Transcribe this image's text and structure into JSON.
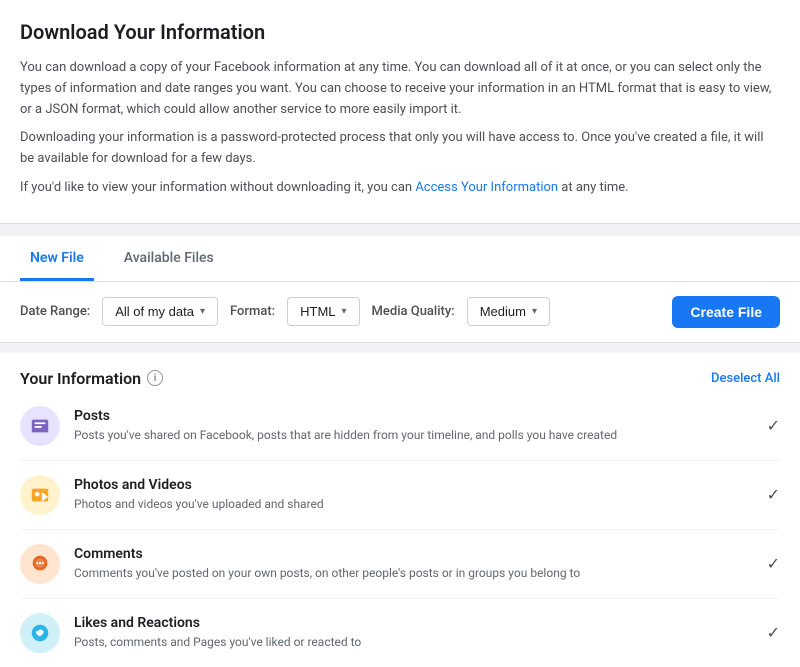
{
  "page": {
    "title": "Download Your Information",
    "description1": "You can download a copy of your Facebook information at any time. You can download all of it at once, or you can select only the types of information and date ranges you want. You can choose to receive your information in an HTML format that is easy to view, or a JSON format, which could allow another service to more easily import it.",
    "description2": "Downloading your information is a password-protected process that only you will have access to. Once you've created a file, it will be available for download for a few days.",
    "description3_pre": "If you'd like to view your information without downloading it, you can ",
    "description3_link": "Access Your Information",
    "description3_post": " at any time."
  },
  "tabs": [
    {
      "id": "new-file",
      "label": "New File",
      "active": true
    },
    {
      "id": "available-files",
      "label": "Available Files",
      "active": false
    }
  ],
  "controls": {
    "date_range_label": "Date Range:",
    "date_range_value": "All of my data",
    "format_label": "Format:",
    "format_value": "HTML",
    "media_quality_label": "Media Quality:",
    "media_quality_value": "Medium",
    "create_button_label": "Create File"
  },
  "your_information": {
    "title": "Your Information",
    "info_icon_label": "i",
    "deselect_all_label": "Deselect All",
    "items": [
      {
        "id": "posts",
        "icon_type": "purple",
        "title": "Posts",
        "description": "Posts you've shared on Facebook, posts that are hidden from your timeline, and polls you have created",
        "checked": true
      },
      {
        "id": "photos-videos",
        "icon_type": "yellow",
        "title": "Photos and Videos",
        "description": "Photos and videos you've uploaded and shared",
        "checked": true
      },
      {
        "id": "comments",
        "icon_type": "orange",
        "title": "Comments",
        "description": "Comments you've posted on your own posts, on other people's posts or in groups you belong to",
        "checked": true
      },
      {
        "id": "likes-reactions",
        "icon_type": "cyan",
        "title": "Likes and Reactions",
        "description": "Posts, comments and Pages you've liked or reacted to",
        "checked": true
      }
    ]
  }
}
